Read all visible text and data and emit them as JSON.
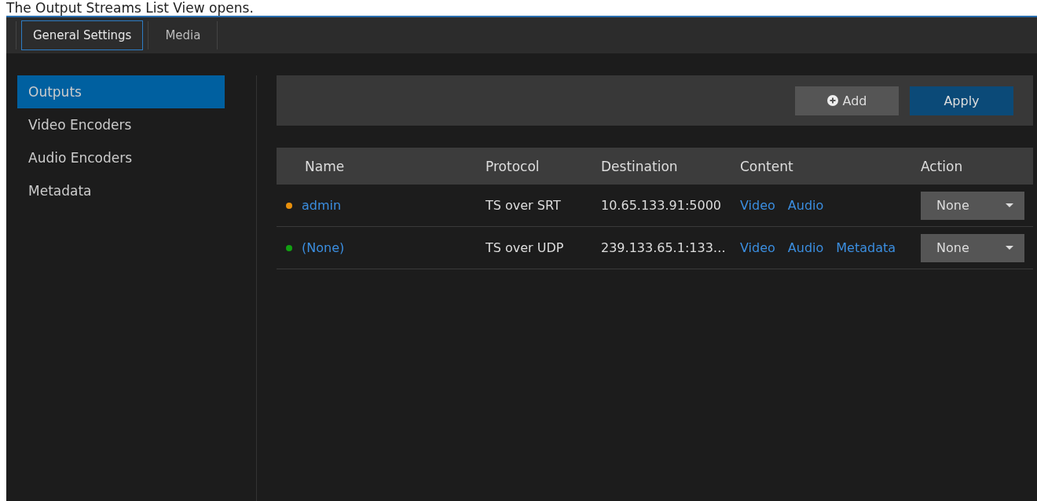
{
  "caption": "The Output Streams List View opens.",
  "tabs": [
    {
      "label": "General Settings",
      "selected": true
    },
    {
      "label": "Media",
      "selected": false
    }
  ],
  "sidebar": {
    "items": [
      {
        "label": "Outputs",
        "selected": true
      },
      {
        "label": "Video Encoders",
        "selected": false
      },
      {
        "label": "Audio Encoders",
        "selected": false
      },
      {
        "label": "Metadata",
        "selected": false
      }
    ]
  },
  "toolbar": {
    "add": "Add",
    "apply": "Apply"
  },
  "table": {
    "columns": [
      "Name",
      "Protocol",
      "Destination",
      "Content",
      "Action"
    ],
    "rows": [
      {
        "name": "admin",
        "color": "#e8900c",
        "protocol": "TS over SRT",
        "destination": "10.65.133.91:5000",
        "content": [
          "Video",
          "Audio"
        ],
        "action": "None"
      },
      {
        "name": "(None)",
        "color": "#12a012",
        "protocol": "TS over UDP",
        "destination": "239.133.65.1:133…",
        "content": [
          "Video",
          "Audio",
          "Metadata"
        ],
        "action": "None"
      }
    ]
  }
}
